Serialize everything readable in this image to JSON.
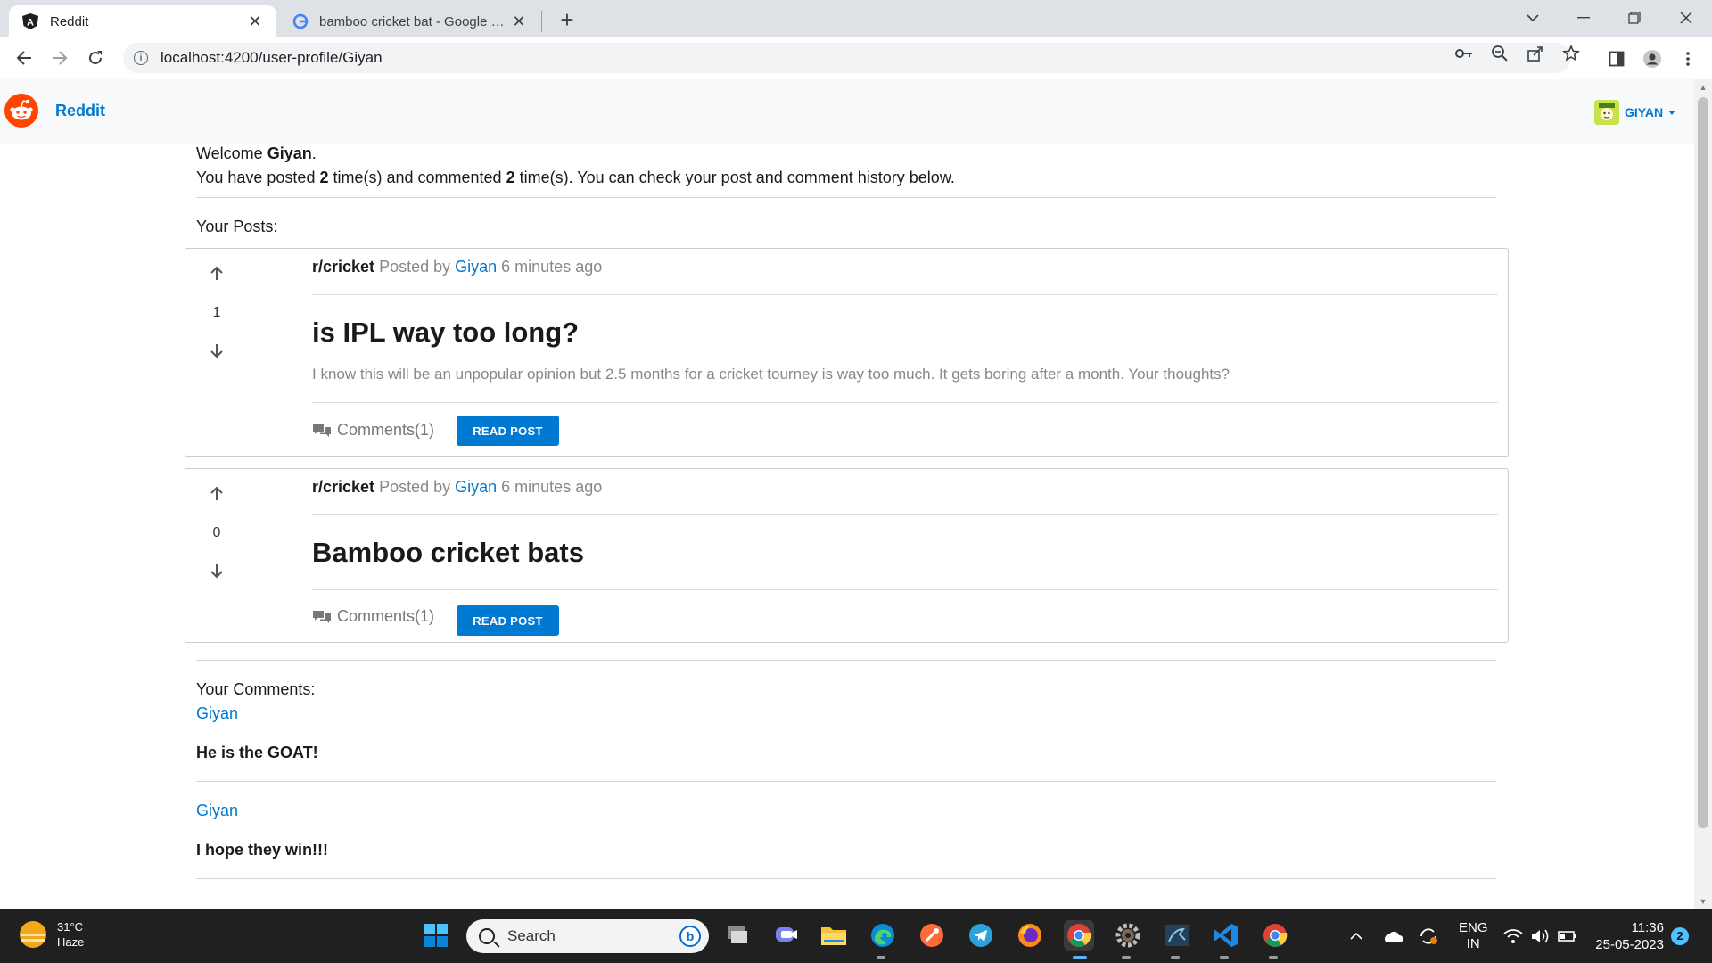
{
  "browser": {
    "tabs": [
      {
        "title": "Reddit",
        "active": true
      },
      {
        "title": "bamboo cricket bat - Google Search",
        "active": false
      }
    ],
    "url": "localhost:4200/user-profile/Giyan"
  },
  "app": {
    "brand": "Reddit",
    "user_menu": {
      "username": "GIYAN"
    }
  },
  "profile": {
    "welcome_prefix": "Welcome ",
    "username": "Giyan",
    "welcome_suffix": ".",
    "summary_1": "You have posted ",
    "post_count": "2",
    "summary_2": " time(s) and commented ",
    "comment_count": "2",
    "summary_3": " time(s). You can check your post and comment history below.",
    "posts_heading": "Your Posts:",
    "comments_heading": "Your Comments:"
  },
  "posts": [
    {
      "subreddit": "r/cricket",
      "posted_by_label": " Posted by ",
      "author": "Giyan",
      "time": " 6 minutes ago",
      "votes": "1",
      "title": "is IPL way too long?",
      "body": "I know this will be an unpopular opinion but 2.5 months for a cricket tourney is way too much. It gets boring after a month. Your thoughts?",
      "comments_label": "Comments(1)",
      "read_label": "READ POST"
    },
    {
      "subreddit": "r/cricket",
      "posted_by_label": " Posted by ",
      "author": "Giyan",
      "time": " 6 minutes ago",
      "votes": "0",
      "title": "Bamboo cricket bats",
      "body": "",
      "comments_label": "Comments(1)",
      "read_label": "READ POST"
    }
  ],
  "comments": [
    {
      "author": "Giyan",
      "text": "He is the GOAT!"
    },
    {
      "author": "Giyan",
      "text": "I hope they win!!!"
    }
  ],
  "taskbar": {
    "weather_temp": "31°C",
    "weather_desc": "Haze",
    "search_label": "Search",
    "lang_1": "ENG",
    "lang_2": "IN",
    "time": "11:36",
    "date": "25-05-2023",
    "notifications": "2"
  },
  "colors": {
    "accent": "#0079d3",
    "brand_orange": "#ff4500"
  }
}
